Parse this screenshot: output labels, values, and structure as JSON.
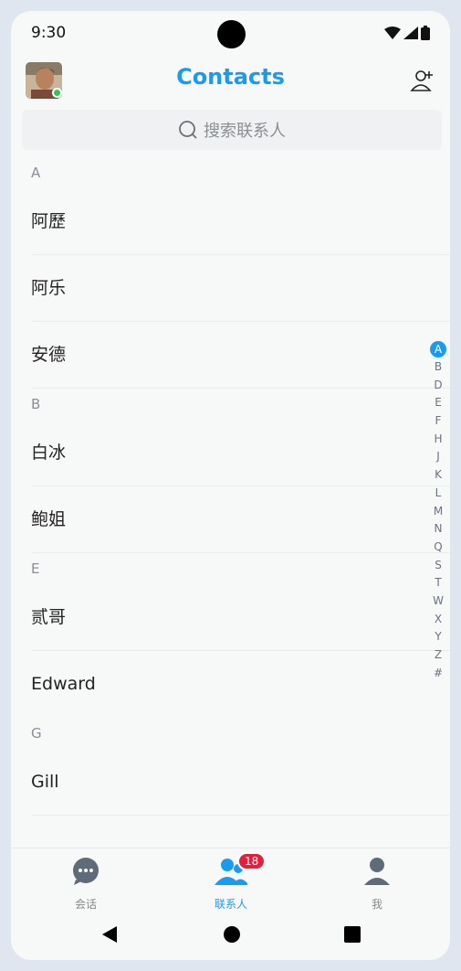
{
  "status": {
    "time": "9:30"
  },
  "header": {
    "title": "Contacts"
  },
  "search": {
    "placeholder": "搜索联系人"
  },
  "sections": [
    {
      "letter": "A",
      "contacts": [
        "阿歷",
        "阿乐",
        "安德"
      ]
    },
    {
      "letter": "B",
      "contacts": [
        "白冰",
        "鲍姐"
      ]
    },
    {
      "letter": "E",
      "contacts": [
        "贰哥",
        "Edward"
      ]
    },
    {
      "letter": "G",
      "contacts": [
        "Gill"
      ]
    }
  ],
  "index_bar": {
    "letters": [
      "A",
      "B",
      "D",
      "E",
      "F",
      "H",
      "J",
      "K",
      "L",
      "M",
      "N",
      "Q",
      "S",
      "T",
      "W",
      "X",
      "Y",
      "Z",
      "#"
    ],
    "active": "A"
  },
  "tabs": [
    {
      "label": "会话",
      "icon": "chat-icon",
      "active": false
    },
    {
      "label": "联系人",
      "icon": "contacts-icon",
      "active": true,
      "badge": "18"
    },
    {
      "label": "我",
      "icon": "profile-icon",
      "active": false
    }
  ],
  "colors": {
    "accent": "#1a9bf0",
    "badge": "#e0203c",
    "online": "#22cc55"
  }
}
